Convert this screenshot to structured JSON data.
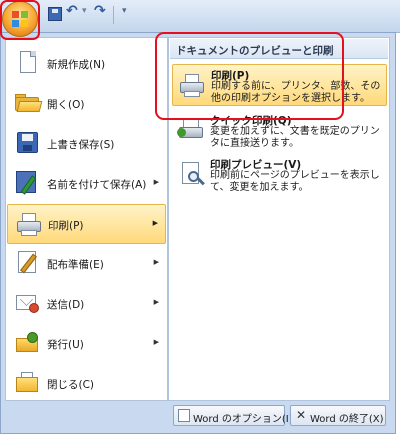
{
  "menu_items": [
    {
      "label": "新規作成(N)",
      "has_arrow": false
    },
    {
      "label": "開く(O)",
      "has_arrow": false
    },
    {
      "label": "上書き保存(S)",
      "has_arrow": false
    },
    {
      "label": "名前を付けて保存(A)",
      "has_arrow": true
    },
    {
      "label": "印刷(P)",
      "has_arrow": true
    },
    {
      "label": "配布準備(E)",
      "has_arrow": true
    },
    {
      "label": "送信(D)",
      "has_arrow": true
    },
    {
      "label": "発行(U)",
      "has_arrow": true
    },
    {
      "label": "閉じる(C)",
      "has_arrow": false
    }
  ],
  "submenu": {
    "header": "ドキュメントのプレビューと印刷",
    "options": [
      {
        "title": "印刷(P)",
        "desc": "印刷する前に、プリンタ、部数、その他の印刷オプションを選択します。"
      },
      {
        "title": "クイック印刷(Q)",
        "desc": "変更を加えずに、文書を既定のプリンタに直接送ります。"
      },
      {
        "title": "印刷プレビュー(V)",
        "desc": "印刷前にページのプレビューを表示して、変更を加えます。"
      }
    ]
  },
  "bottom_buttons": {
    "options_label": "Word のオプション(I)",
    "exit_label": "Word の終了(X)"
  },
  "quick_access": {
    "undo_glyph": "↶",
    "redo_glyph": "↷",
    "dropdown_glyph": "▾",
    "customize_glyph": "▾"
  },
  "glyphs": {
    "submenu_arrow": "▶",
    "close_x": "✕"
  },
  "colors": {
    "frame": "#c9daf0",
    "highlight_bg": "#ffd97b",
    "highlight_border": "#e7b64b",
    "annotation_red": "#e4101d"
  },
  "selected_item": "印刷(P)",
  "selected_option": "印刷(P)"
}
